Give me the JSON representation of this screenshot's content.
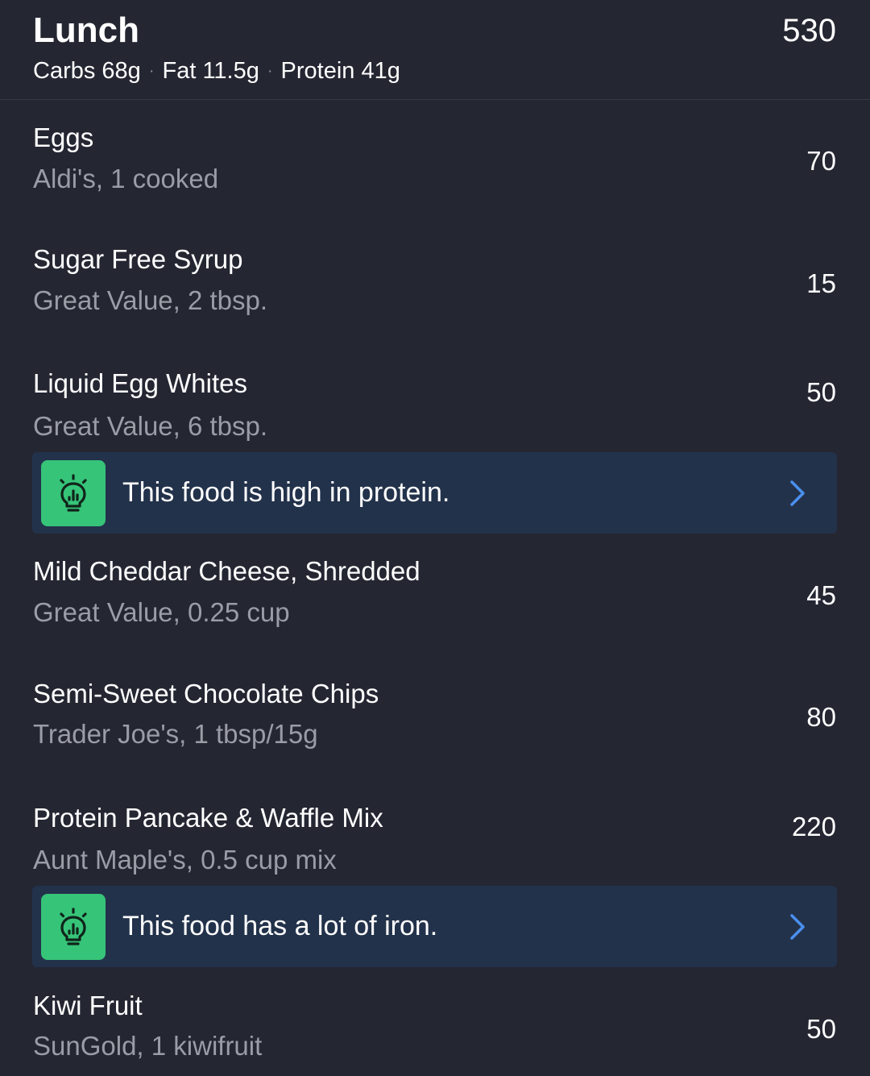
{
  "meal": {
    "title": "Lunch",
    "calories": "530",
    "macros": {
      "carbs": "Carbs 68g",
      "fat": "Fat 11.5g",
      "protein": "Protein 41g",
      "separator": "·"
    }
  },
  "entries": [
    {
      "name": "Eggs",
      "detail": "Aldi's, 1 cooked",
      "calories": "70"
    },
    {
      "name": "Sugar Free Syrup",
      "detail": "Great Value, 2 tbsp.",
      "calories": "15"
    },
    {
      "name": "Liquid Egg Whites",
      "detail": "Great Value, 6 tbsp.",
      "calories": "50"
    },
    {
      "name": "Mild Cheddar Cheese, Shredded",
      "detail": "Great Value, 0.25 cup",
      "calories": "45"
    },
    {
      "name": "Semi-Sweet Chocolate Chips",
      "detail": "Trader Joe's, 1 tbsp/15g",
      "calories": "80"
    },
    {
      "name": "Protein Pancake & Waffle Mix",
      "detail": "Aunt Maple's, 0.5 cup mix",
      "calories": "220"
    },
    {
      "name": "Kiwi Fruit",
      "detail": "SunGold, 1 kiwifruit",
      "calories": "50"
    }
  ],
  "insights": [
    {
      "text": "This food is high in protein.",
      "icon": "lightbulb-icon",
      "chevron": "chevron-right-icon"
    },
    {
      "text": "This food has a lot of iron.",
      "icon": "lightbulb-icon",
      "chevron": "chevron-right-icon"
    }
  ],
  "colors": {
    "background": "#242632",
    "insight_background": "#23324b",
    "insight_icon_background": "#36c479",
    "chevron": "#4a90f0",
    "secondary_text": "#9a9ca6"
  }
}
